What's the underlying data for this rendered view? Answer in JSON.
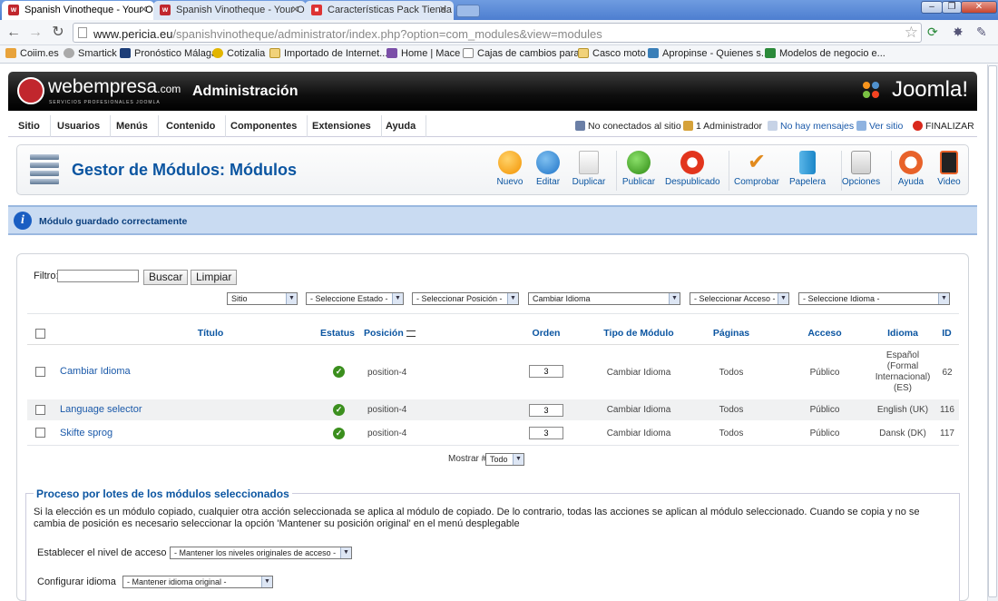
{
  "browser": {
    "tabs": [
      {
        "title": "Spanish Vinotheque - Your Or",
        "active": true
      },
      {
        "title": "Spanish Vinotheque - Your Or",
        "active": false
      },
      {
        "title": "Características Pack Tienda -",
        "active": false
      }
    ],
    "url_host": "www.pericia.eu",
    "url_path": "/spanishvinotheque/administrator/index.php?option=com_modules&view=modules",
    "bookmarks": [
      "Coiim.es",
      "Smartick",
      "Pronóstico Málaga",
      "Cotizalia",
      "Importado de Internet...",
      "Home | Mace",
      "Cajas de cambios para...",
      "Casco moto",
      "Apropinse - Quienes s...",
      "Modelos de negocio e..."
    ]
  },
  "header": {
    "logo_text": "webempresa",
    "logo_suffix": ".com",
    "logo_sub": "SERVICIOS PROFESIONALES JOOMLA",
    "title": "Administración",
    "brand": "Joomla!"
  },
  "menu": {
    "items": [
      "Sitio",
      "Usuarios",
      "Menús",
      "Contenido",
      "Componentes",
      "Extensiones",
      "Ayuda"
    ],
    "status": {
      "offline": "No conectados al sitio",
      "admins": "1 Administrador",
      "messages": "No hay mensajes",
      "view_site": "Ver sitio",
      "logout": "FINALIZAR"
    }
  },
  "toolbar": {
    "title": "Gestor de Módulos: Módulos",
    "buttons": [
      "Nuevo",
      "Editar",
      "Duplicar",
      "Publicar",
      "Despublicado",
      "Comprobar",
      "Papelera",
      "Opciones",
      "Ayuda",
      "Video"
    ]
  },
  "message": "Módulo guardado correctamente",
  "filters": {
    "label": "Filtro:",
    "search_value": "",
    "search_button": "Buscar",
    "clear_button": "Limpiar",
    "selects": [
      "Sitio",
      "- Seleccione Estado -",
      "- Seleccionar Posición -",
      "Cambiar Idioma",
      "- Seleccionar Acceso -",
      "- Seleccione Idioma -"
    ]
  },
  "table": {
    "headers": [
      "Título",
      "Estatus",
      "Posición",
      "Orden",
      "Tipo de Módulo",
      "Páginas",
      "Acceso",
      "Idioma",
      "ID"
    ],
    "rows": [
      {
        "title": "Cambiar Idioma",
        "position": "position-4",
        "order": "3",
        "type": "Cambiar Idioma",
        "pages": "Todos",
        "access": "Público",
        "language": "Español (Formal Internacional) (ES)",
        "id": "62"
      },
      {
        "title": "Language selector",
        "position": "position-4",
        "order": "3",
        "type": "Cambiar Idioma",
        "pages": "Todos",
        "access": "Público",
        "language": "English (UK)",
        "id": "116"
      },
      {
        "title": "Skifte sprog",
        "position": "position-4",
        "order": "3",
        "type": "Cambiar Idioma",
        "pages": "Todos",
        "access": "Público",
        "language": "Dansk (DK)",
        "id": "117"
      }
    ],
    "show_label": "Mostrar #",
    "show_value": "Todo"
  },
  "batch": {
    "title": "Proceso por lotes de los módulos seleccionados",
    "description": "Si la elección es un módulo copiado, cualquier otra acción seleccionada se aplica al módulo de copiado. De lo contrario, todas las acciones se aplican al módulo seleccionado. Cuando se copia y no se cambia de posición es necesario seleccionar la opción 'Mantener su posición original' en el menú desplegable",
    "access_label": "Establecer el nivel de acceso",
    "access_value": "- Mantener los niveles originales de acceso -",
    "language_label": "Configurar idioma",
    "language_value": "- Mantener idioma original -"
  }
}
